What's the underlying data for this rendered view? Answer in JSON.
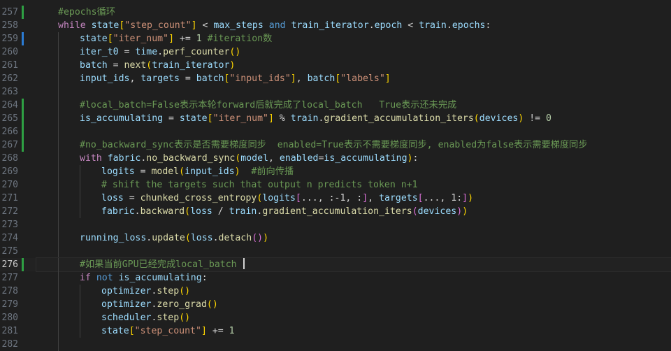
{
  "editor": {
    "active_line": "276",
    "lines": [
      {
        "num": "257",
        "indent": 1,
        "mark": "added",
        "tokens": [
          [
            "#epochs循环",
            "cmt"
          ]
        ]
      },
      {
        "num": "258",
        "indent": 1,
        "mark": "",
        "tokens": [
          [
            "while",
            "ctrl"
          ],
          [
            " state",
            "plain"
          ],
          [
            "[",
            "p1"
          ],
          [
            "\"step_count\"",
            "str"
          ],
          [
            "]",
            "p1"
          ],
          [
            " < ",
            "op"
          ],
          [
            "max_steps",
            "plain"
          ],
          [
            " and ",
            "kw"
          ],
          [
            "train_iterator",
            "plain"
          ],
          [
            ".",
            "op"
          ],
          [
            "epoch",
            "plain"
          ],
          [
            " < ",
            "op"
          ],
          [
            "train",
            "plain"
          ],
          [
            ".",
            "op"
          ],
          [
            "epochs",
            "plain"
          ],
          [
            ":",
            "op"
          ]
        ]
      },
      {
        "num": "259",
        "indent": 2,
        "mark": "modified",
        "tokens": [
          [
            "state",
            "plain"
          ],
          [
            "[",
            "p1"
          ],
          [
            "\"iter_num\"",
            "str"
          ],
          [
            "]",
            "p1"
          ],
          [
            " += ",
            "op"
          ],
          [
            "1",
            "num"
          ],
          [
            " #iteration数",
            "cmt"
          ]
        ]
      },
      {
        "num": "260",
        "indent": 2,
        "mark": "",
        "tokens": [
          [
            "iter_t0",
            "plain"
          ],
          [
            " = ",
            "op"
          ],
          [
            "time",
            "plain"
          ],
          [
            ".",
            "op"
          ],
          [
            "perf_counter",
            "fn"
          ],
          [
            "()",
            "p1"
          ]
        ]
      },
      {
        "num": "261",
        "indent": 2,
        "mark": "",
        "tokens": [
          [
            "batch",
            "plain"
          ],
          [
            " = ",
            "op"
          ],
          [
            "next",
            "fn"
          ],
          [
            "(",
            "p1"
          ],
          [
            "train_iterator",
            "plain"
          ],
          [
            ")",
            "p1"
          ]
        ]
      },
      {
        "num": "262",
        "indent": 2,
        "mark": "",
        "tokens": [
          [
            "input_ids",
            "plain"
          ],
          [
            ", ",
            "op"
          ],
          [
            "targets",
            "plain"
          ],
          [
            " = ",
            "op"
          ],
          [
            "batch",
            "plain"
          ],
          [
            "[",
            "p1"
          ],
          [
            "\"input_ids\"",
            "str"
          ],
          [
            "]",
            "p1"
          ],
          [
            ", ",
            "op"
          ],
          [
            "batch",
            "plain"
          ],
          [
            "[",
            "p1"
          ],
          [
            "\"labels\"",
            "str"
          ],
          [
            "]",
            "p1"
          ]
        ]
      },
      {
        "num": "263",
        "indent": 2,
        "mark": "",
        "tokens": []
      },
      {
        "num": "264",
        "indent": 2,
        "mark": "added",
        "tokens": [
          [
            "#local_batch=False表示本轮forward后就完成了local_batch   True表示还未完成",
            "cmt"
          ]
        ]
      },
      {
        "num": "265",
        "indent": 2,
        "mark": "added",
        "tokens": [
          [
            "is_accumulating",
            "plain"
          ],
          [
            " = ",
            "op"
          ],
          [
            "state",
            "plain"
          ],
          [
            "[",
            "p1"
          ],
          [
            "\"iter_num\"",
            "str"
          ],
          [
            "]",
            "p1"
          ],
          [
            " % ",
            "op"
          ],
          [
            "train",
            "plain"
          ],
          [
            ".",
            "op"
          ],
          [
            "gradient_accumulation_iters",
            "fn"
          ],
          [
            "(",
            "p1"
          ],
          [
            "devices",
            "plain"
          ],
          [
            ")",
            "p1"
          ],
          [
            " != ",
            "op"
          ],
          [
            "0",
            "num"
          ]
        ]
      },
      {
        "num": "266",
        "indent": 2,
        "mark": "added",
        "tokens": []
      },
      {
        "num": "267",
        "indent": 2,
        "mark": "added",
        "tokens": [
          [
            "#no_backward_sync表示是否需要梯度同步  enabled=True表示不需要梯度同步, enabled为false表示需要梯度同步",
            "cmt"
          ]
        ]
      },
      {
        "num": "268",
        "indent": 2,
        "mark": "",
        "tokens": [
          [
            "with",
            "ctrl"
          ],
          [
            " fabric",
            "plain"
          ],
          [
            ".",
            "op"
          ],
          [
            "no_backward_sync",
            "fn"
          ],
          [
            "(",
            "p1"
          ],
          [
            "model",
            "plain"
          ],
          [
            ", ",
            "op"
          ],
          [
            "enabled",
            "plain"
          ],
          [
            "=",
            "op"
          ],
          [
            "is_accumulating",
            "plain"
          ],
          [
            ")",
            "p1"
          ],
          [
            ":",
            "op"
          ]
        ]
      },
      {
        "num": "269",
        "indent": 3,
        "mark": "",
        "tokens": [
          [
            "logits",
            "plain"
          ],
          [
            " = ",
            "op"
          ],
          [
            "model",
            "fn"
          ],
          [
            "(",
            "p1"
          ],
          [
            "input_ids",
            "plain"
          ],
          [
            ")",
            "p1"
          ],
          [
            "  #前向传播",
            "cmt"
          ]
        ]
      },
      {
        "num": "270",
        "indent": 3,
        "mark": "",
        "tokens": [
          [
            "# shift the targets such that output n predicts token n+1",
            "cmt"
          ]
        ]
      },
      {
        "num": "271",
        "indent": 3,
        "mark": "",
        "tokens": [
          [
            "loss",
            "plain"
          ],
          [
            " = ",
            "op"
          ],
          [
            "chunked_cross_entropy",
            "fn"
          ],
          [
            "(",
            "p1"
          ],
          [
            "logits",
            "plain"
          ],
          [
            "[",
            "p2"
          ],
          [
            "..., :-1, :",
            "op"
          ],
          [
            "]",
            "p2"
          ],
          [
            ", ",
            "op"
          ],
          [
            "targets",
            "plain"
          ],
          [
            "[",
            "p2"
          ],
          [
            "..., 1:",
            "op"
          ],
          [
            "]",
            "p2"
          ],
          [
            ")",
            "p1"
          ]
        ]
      },
      {
        "num": "272",
        "indent": 3,
        "mark": "",
        "tokens": [
          [
            "fabric",
            "plain"
          ],
          [
            ".",
            "op"
          ],
          [
            "backward",
            "fn"
          ],
          [
            "(",
            "p1"
          ],
          [
            "loss",
            "plain"
          ],
          [
            " / ",
            "op"
          ],
          [
            "train",
            "plain"
          ],
          [
            ".",
            "op"
          ],
          [
            "gradient_accumulation_iters",
            "fn"
          ],
          [
            "(",
            "p2"
          ],
          [
            "devices",
            "plain"
          ],
          [
            ")",
            "p2"
          ],
          [
            ")",
            "p1"
          ]
        ]
      },
      {
        "num": "273",
        "indent": 2,
        "mark": "",
        "tokens": []
      },
      {
        "num": "274",
        "indent": 2,
        "mark": "",
        "tokens": [
          [
            "running_loss",
            "plain"
          ],
          [
            ".",
            "op"
          ],
          [
            "update",
            "fn"
          ],
          [
            "(",
            "p1"
          ],
          [
            "loss",
            "plain"
          ],
          [
            ".",
            "op"
          ],
          [
            "detach",
            "fn"
          ],
          [
            "()",
            "p2"
          ],
          [
            ")",
            "p1"
          ]
        ]
      },
      {
        "num": "275",
        "indent": 2,
        "mark": "",
        "tokens": []
      },
      {
        "num": "276",
        "indent": 2,
        "mark": "added",
        "tokens": [
          [
            "#如果当前GPU已经完成local_batch ",
            "cmt"
          ]
        ]
      },
      {
        "num": "277",
        "indent": 2,
        "mark": "",
        "tokens": [
          [
            "if",
            "ctrl"
          ],
          [
            " not ",
            "kw"
          ],
          [
            "is_accumulating",
            "plain"
          ],
          [
            ":",
            "op"
          ]
        ]
      },
      {
        "num": "278",
        "indent": 3,
        "mark": "",
        "tokens": [
          [
            "optimizer",
            "plain"
          ],
          [
            ".",
            "op"
          ],
          [
            "step",
            "fn"
          ],
          [
            "()",
            "p1"
          ]
        ]
      },
      {
        "num": "279",
        "indent": 3,
        "mark": "",
        "tokens": [
          [
            "optimizer",
            "plain"
          ],
          [
            ".",
            "op"
          ],
          [
            "zero_grad",
            "fn"
          ],
          [
            "()",
            "p1"
          ]
        ]
      },
      {
        "num": "280",
        "indent": 3,
        "mark": "",
        "tokens": [
          [
            "scheduler",
            "plain"
          ],
          [
            ".",
            "op"
          ],
          [
            "step",
            "fn"
          ],
          [
            "()",
            "p1"
          ]
        ]
      },
      {
        "num": "281",
        "indent": 3,
        "mark": "",
        "tokens": [
          [
            "state",
            "plain"
          ],
          [
            "[",
            "p1"
          ],
          [
            "\"step_count\"",
            "str"
          ],
          [
            "]",
            "p1"
          ],
          [
            " += ",
            "op"
          ],
          [
            "1",
            "num"
          ]
        ]
      },
      {
        "num": "282",
        "indent": 2,
        "mark": "",
        "tokens": []
      }
    ]
  }
}
